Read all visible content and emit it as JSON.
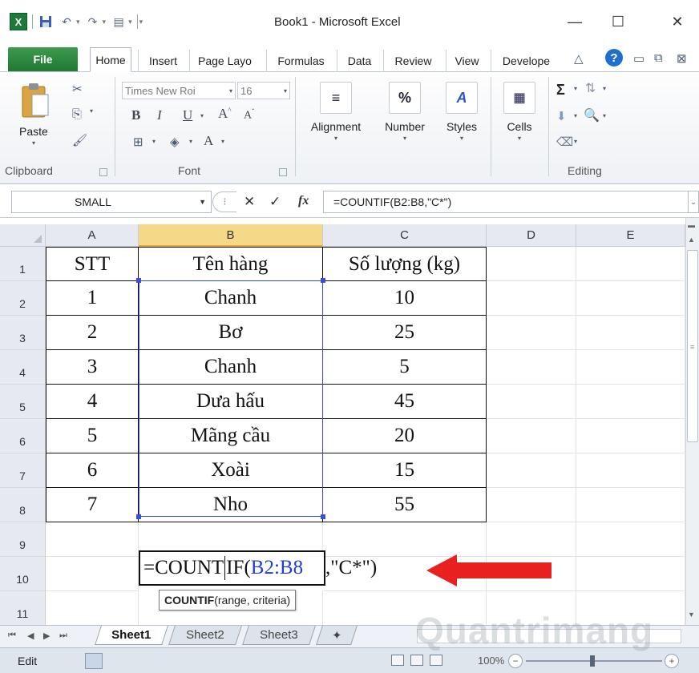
{
  "window": {
    "title": "Book1 - Microsoft Excel",
    "minimize": "—",
    "maximize": "☐",
    "close": "✕"
  },
  "ribbon_tabs": [
    "Home",
    "Insert",
    "Page Layo",
    "Formulas",
    "Data",
    "Review",
    "View",
    "Develope"
  ],
  "file_tab": "File",
  "ribbon": {
    "clipboard": {
      "label": "Clipboard",
      "paste": "Paste"
    },
    "font": {
      "label": "Font",
      "name": "Times New Roi",
      "size": "16"
    },
    "alignment": "Alignment",
    "number": "Number",
    "styles": "Styles",
    "cells": "Cells",
    "editing": "Editing"
  },
  "formula_bar": {
    "name_box": "SMALL",
    "formula": "=COUNTIF(B2:B8,\"C*\")"
  },
  "columns": [
    "A",
    "B",
    "C",
    "D",
    "E"
  ],
  "rows": [
    "1",
    "2",
    "3",
    "4",
    "5",
    "6",
    "7",
    "8",
    "9",
    "10",
    "11"
  ],
  "table": {
    "headers": [
      "STT",
      "Tên hàng",
      "Số lượng (kg)"
    ],
    "rows": [
      [
        "1",
        "Chanh",
        "10"
      ],
      [
        "2",
        "Bơ",
        "25"
      ],
      [
        "3",
        "Chanh",
        "5"
      ],
      [
        "4",
        "Dưa hấu",
        "45"
      ],
      [
        "5",
        "Mãng cầu",
        "20"
      ],
      [
        "6",
        "Xoài",
        "15"
      ],
      [
        "7",
        "Nho",
        "55"
      ]
    ]
  },
  "editing_cell": {
    "part1": "=COUNT",
    "part2": "IF(",
    "ref": "B2:B8",
    "part3": ",\"C*\")"
  },
  "tooltip": {
    "fn": "COUNTIF",
    "args": "(range, criteria)"
  },
  "sheets": [
    "Sheet1",
    "Sheet2",
    "Sheet3"
  ],
  "status": {
    "mode": "Edit",
    "zoom": "100%"
  },
  "watermark": "Quantrimang",
  "colors": {
    "excel_green": "#1f7a32",
    "selection_blue": "#3a4ed8",
    "arrow_red": "#e8201f",
    "selected_header": "#f6d889"
  }
}
